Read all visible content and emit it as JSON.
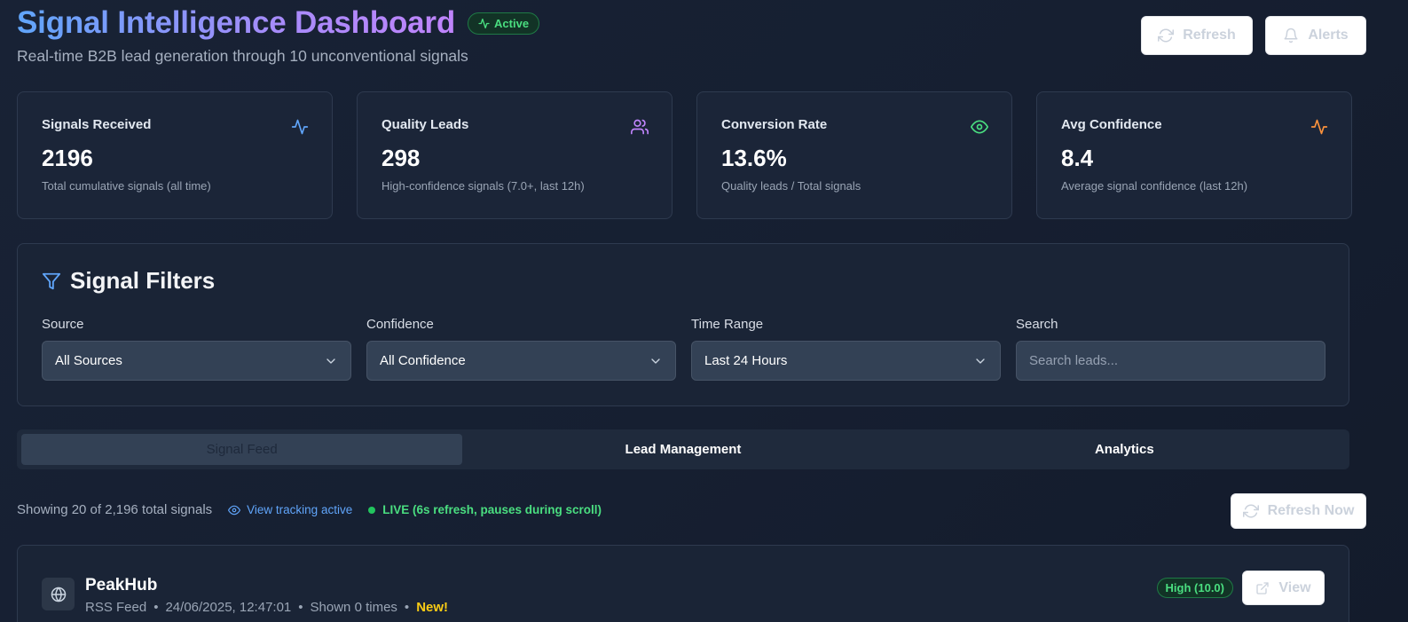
{
  "header": {
    "title": "Signal Intelligence Dashboard",
    "status_badge": "Active",
    "subtitle": "Real-time B2B lead generation through 10 unconventional signals",
    "refresh_label": "Refresh",
    "alerts_label": "Alerts"
  },
  "stats": [
    {
      "label": "Signals Received",
      "value": "2196",
      "desc": "Total cumulative signals (all time)",
      "icon": "activity-icon",
      "icon_color": "#60a5fa"
    },
    {
      "label": "Quality Leads",
      "value": "298",
      "desc": "High-confidence signals (7.0+, last 12h)",
      "icon": "users-icon",
      "icon_color": "#c084fc"
    },
    {
      "label": "Conversion Rate",
      "value": "13.6%",
      "desc": "Quality leads / Total signals",
      "icon": "eye-icon",
      "icon_color": "#4ade80"
    },
    {
      "label": "Avg Confidence",
      "value": "8.4",
      "desc": "Average signal confidence (last 12h)",
      "icon": "activity-icon",
      "icon_color": "#fb923c"
    }
  ],
  "filters": {
    "title": "Signal Filters",
    "source": {
      "label": "Source",
      "value": "All Sources"
    },
    "confidence": {
      "label": "Confidence",
      "value": "All Confidence"
    },
    "time_range": {
      "label": "Time Range",
      "value": "Last 24 Hours"
    },
    "search": {
      "label": "Search",
      "placeholder": "Search leads..."
    }
  },
  "tabs": [
    "Signal Feed",
    "Lead Management",
    "Analytics"
  ],
  "feed": {
    "showing": "Showing 20 of 2,196 total signals",
    "tracking": "View tracking active",
    "live": "LIVE (6s refresh, pauses during scroll)",
    "refresh_now_label": "Refresh Now"
  },
  "signals": [
    {
      "name": "PeakHub",
      "source": "RSS Feed",
      "timestamp": "24/06/2025, 12:47:01",
      "shown": "Shown 0 times",
      "new_label": "New!",
      "confidence": "High (10.0)",
      "view_label": "View"
    }
  ],
  "colors": {
    "accent_blue": "#60a5fa",
    "accent_purple": "#a78bfa",
    "success_green": "#4ade80",
    "new_yellow": "#facc15"
  }
}
